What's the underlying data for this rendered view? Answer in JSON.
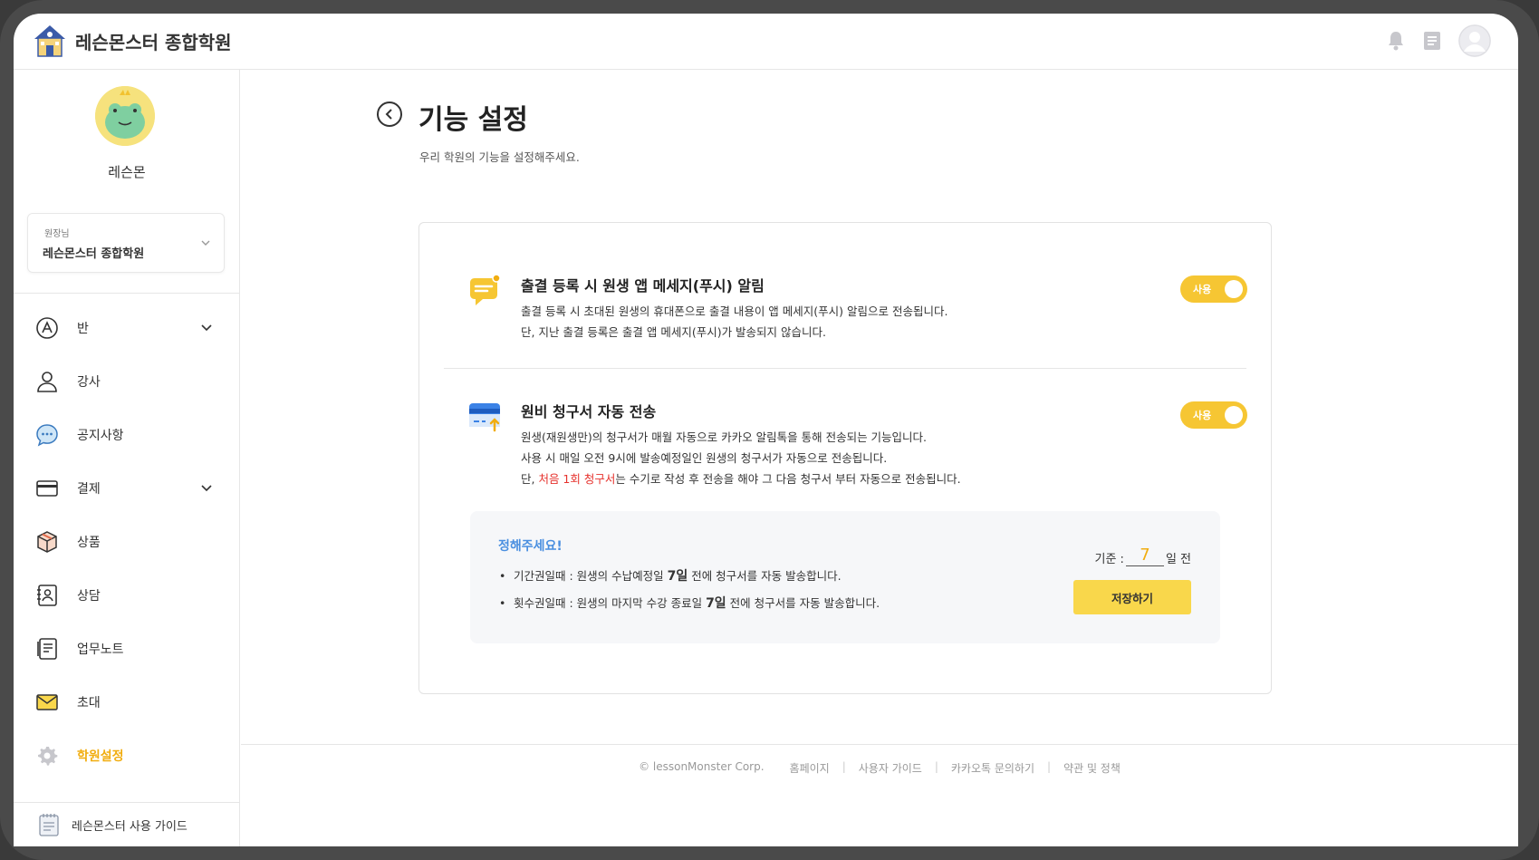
{
  "header": {
    "brand": "레슨몬스터 종합학원"
  },
  "sidebar": {
    "profile_name": "레슨몬",
    "role_label": "원장님",
    "role_value": "레슨몬스터 종합학원",
    "items": [
      {
        "label": "반"
      },
      {
        "label": "강사"
      },
      {
        "label": "공지사항"
      },
      {
        "label": "결제"
      },
      {
        "label": "상품"
      },
      {
        "label": "상담"
      },
      {
        "label": "업무노트"
      },
      {
        "label": "초대"
      },
      {
        "label": "학원설정"
      }
    ],
    "guide_label": "레슨몬스터 사용 가이드"
  },
  "main": {
    "title": "기능 설정",
    "subtitle": "우리 학원의 기능을 설정해주세요.",
    "feature_push": {
      "title": "출결 등록 시 원생 앱 메세지(푸시) 알림",
      "line1": "출결 등록 시 초대된 원생의 휴대폰으로 출결 내용이 앱 메세지(푸시) 알림으로 전송됩니다.",
      "line2": "단, 지난 출결 등록은 출결 앱 메세지(푸시)가 발송되지 않습니다.",
      "toggle_label": "사용"
    },
    "feature_invoice": {
      "title": "원비 청구서 자동 전송",
      "line1": "원생(재원생만)의 청구서가 매월 자동으로 카카오 알림톡을 통해 전송되는 기능입니다.",
      "line2": "사용 시 매일 오전 9시에 발송예정일인 원생의 청구서가 자동으로 전송됩니다.",
      "line3_pre": "단, ",
      "line3_red": "처음 1회 청구서",
      "line3_post": "는 수기로 작성 후 전송을 해야 그 다음 청구서 부터 자동으로 전송됩니다.",
      "toggle_label": "사용"
    },
    "setting_box": {
      "title": "정해주세요!",
      "item1_pre": "기간권일때 : 원생의 수납예정일 ",
      "item1_bold": "7일",
      "item1_post": " 전에 청구서를 자동 발송합니다.",
      "item2_pre": "횟수권일때 : 원생의 마지막 수강 종료일 ",
      "item2_bold": "7일",
      "item2_post": " 전에 청구서를 자동 발송합니다.",
      "criterion_label": "기준 :",
      "criterion_value": "7",
      "criterion_unit": "일 전",
      "save_label": "저장하기"
    }
  },
  "footer": {
    "copyright": "© lessonMonster Corp.",
    "links": [
      "홈페이지",
      "사용자 가이드",
      "카카오톡 문의하기",
      "약관 및 정책"
    ]
  },
  "colors": {
    "accent": "#f6c633",
    "active_nav": "#f1ad10",
    "highlight_red": "#e6322d",
    "box_title": "#4a8fe0"
  }
}
